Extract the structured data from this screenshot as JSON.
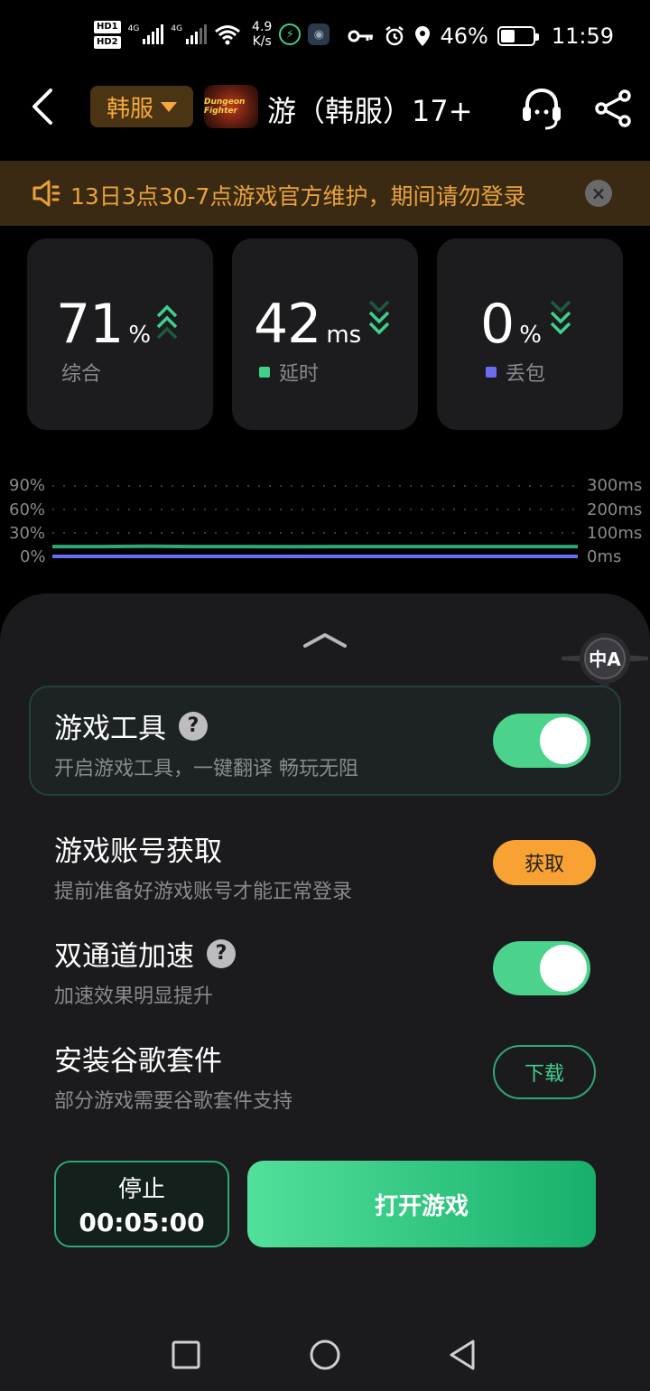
{
  "status_bar": {
    "sim1": "HD",
    "sim1_num": "1",
    "sim2": "HD",
    "sim2_num": "2",
    "net1": "4G",
    "net2": "4G",
    "speed_value": "4.9",
    "speed_unit": "K/s",
    "battery": "46%",
    "battery_level": 0.46,
    "time": "11:59"
  },
  "topnav": {
    "region": "韩服",
    "game_title": "游（韩服）17+",
    "logo_text": "Dungeon Fighter"
  },
  "notice": {
    "text": "13日3点30-7点游戏官方维护，期间请勿登录"
  },
  "stats": {
    "overall": {
      "value": "71",
      "unit": "%",
      "label": "综合"
    },
    "latency": {
      "value": "42",
      "unit": "ms",
      "label": "延时",
      "color": "#3fd08a"
    },
    "loss": {
      "value": "0",
      "unit": "%",
      "label": "丢包",
      "color": "#6d6cf0"
    }
  },
  "chart": {
    "left_ticks": [
      "90%",
      "60%",
      "30%",
      "0%"
    ],
    "right_ticks": [
      "300ms",
      "200ms",
      "100ms",
      "0ms"
    ]
  },
  "chart_data": {
    "type": "line",
    "series": [
      {
        "color": "#2fa774",
        "values": [
          42,
          42,
          43,
          42,
          42,
          41,
          42,
          42,
          42,
          42,
          42,
          42
        ]
      },
      {
        "color": "#6d6cf0",
        "values": [
          0,
          0,
          0,
          0,
          0,
          0,
          0,
          0,
          0,
          0,
          0,
          0
        ]
      }
    ],
    "ylim_left": [
      0,
      90
    ],
    "ylim_right": [
      0,
      300
    ],
    "grid": true
  },
  "sheet": {
    "game_tools": {
      "title": "游戏工具",
      "subtitle": "开启游戏工具，一键翻译 畅玩无阻",
      "enabled": true
    },
    "account": {
      "title": "游戏账号获取",
      "subtitle": "提前准备好游戏账号才能正常登录",
      "button": "获取"
    },
    "dual_channel": {
      "title": "双通道加速",
      "subtitle": "加速效果明显提升",
      "enabled": true
    },
    "google": {
      "title": "安装谷歌套件",
      "subtitle": "部分游戏需要谷歌套件支持",
      "button": "下载"
    },
    "stop": {
      "label": "停止",
      "timer": "00:05:00"
    },
    "open_game": "打开游戏",
    "translate_badge": "中A"
  }
}
